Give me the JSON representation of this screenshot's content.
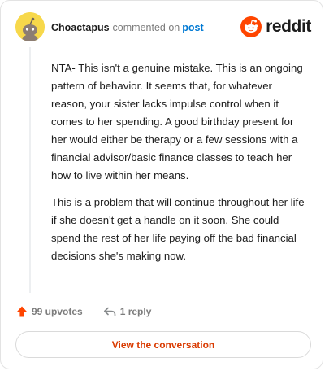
{
  "header": {
    "username": "Choactapus",
    "action": "commented on",
    "post_link": "post",
    "brand": "reddit"
  },
  "comment": {
    "paragraphs": [
      "NTA- This isn't a genuine mistake. This is an ongoing pattern of behavior. It seems that, for whatever reason, your sister lacks impulse control when it comes to her spending. A good birthday present for her would either be therapy or a few sessions with a financial advisor/basic finance classes to teach her how to live within her means.",
      "This is a problem that will continue throughout her life if she doesn't get a handle on it soon. She could spend the rest of her life paying off the bad financial decisions she's making now."
    ]
  },
  "footer": {
    "upvotes": "99 upvotes",
    "replies": "1 reply"
  },
  "cta": {
    "label": "View the conversation"
  },
  "colors": {
    "accent": "#0079d3",
    "brand_orange": "#ff4500",
    "cta_text": "#d93a00",
    "avatar_bg": "#f7d84b"
  },
  "icons": {
    "upvote": "upvote-arrow-icon",
    "reply": "reply-arrow-icon",
    "brand": "reddit-snoo-icon"
  }
}
